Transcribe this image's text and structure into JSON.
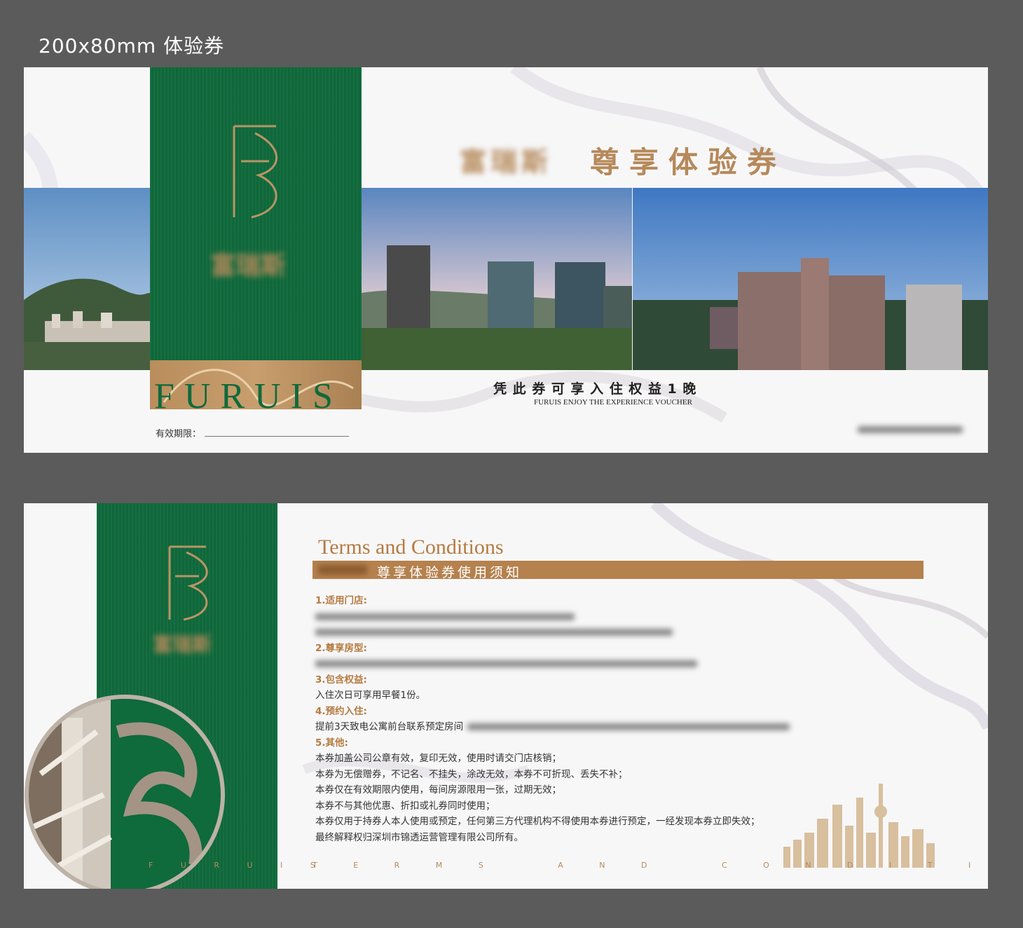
{
  "header": {
    "title": "200x80mm 体验券"
  },
  "front": {
    "brand_cn": "富瑞斯",
    "title": "尊享体验券",
    "logo_letters": "FRS",
    "brand_en": "FURUIS",
    "voucher_line": "凭 此 券 可 享 入 住 权 益 1 晚",
    "voucher_en": "FURUIS ENJOY THE EXPERIENCE VOUCHER",
    "validity_label": "有效期限："
  },
  "back": {
    "heading_en": "Terms and Conditions",
    "heading_cn": "尊享体验券使用须知",
    "sections": [
      {
        "title": "1.适用门店:",
        "lines": []
      },
      {
        "title": "2.尊享房型:",
        "lines": []
      },
      {
        "title": "3.包含权益:",
        "lines": [
          "入住次日可享用早餐1份。"
        ]
      },
      {
        "title": "4.预约入住:",
        "lines": [
          "提前3天致电公寓前台联系预定房间"
        ]
      },
      {
        "title": "5.其他:",
        "lines": [
          "本券加盖公司公章有效，复印无效，使用时请交门店核销；",
          "本券为无偿赠券，不记名、不挂失，涂改无效，本券不可折现、丢失不补；",
          "本券仅在有效期限内使用，每间房源限用一张，过期无效；",
          "本券不与其他优惠、折扣或礼券同时使用；",
          "本券仅用于持券人本人使用或预定，任何第三方代理机构不得使用本券进行预定，一经发现本券立即失效；",
          "最终解释权归深圳市锦透运营管理有限公司所有。"
        ]
      }
    ],
    "footer_brand": "F U R U I S",
    "footer_terms": "T E R M S   A N D   C O N D I T I O N S"
  },
  "colors": {
    "green": "#0f6a3c",
    "gold": "#b6895a",
    "background": "#5b5b5b"
  }
}
